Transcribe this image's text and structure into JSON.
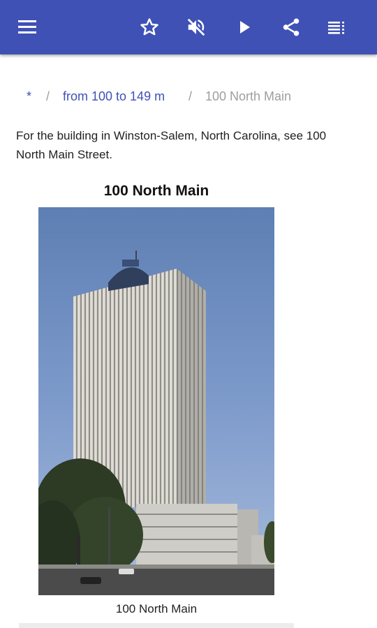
{
  "toolbar": {
    "icons": [
      "menu-icon",
      "star-icon",
      "volume-off-icon",
      "play-icon",
      "share-icon",
      "playlist-icon"
    ],
    "color": "#3f51b5"
  },
  "breadcrumb": {
    "root": "*",
    "separator": "/",
    "category": "from 100 to 149 m",
    "current": "100 North Main"
  },
  "article": {
    "hatnote": "For the building in Winston-Salem, North Carolina, see 100 North Main Street.",
    "infobox_title": "100 North Main",
    "image_caption": "100 North Main"
  },
  "colors": {
    "accent": "#3f51b5",
    "link": "#3f51b5",
    "muted": "#9e9e9e"
  }
}
